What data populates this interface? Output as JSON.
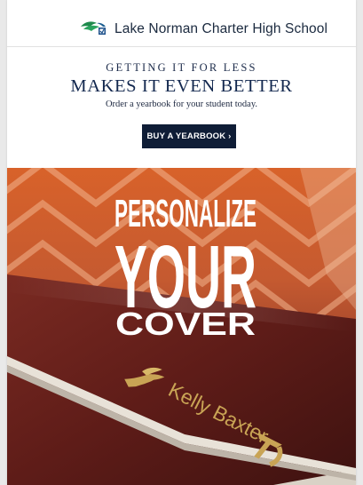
{
  "header": {
    "school_name": "Lake Norman Charter High School",
    "logo_icon": "bird-logo-icon"
  },
  "promo": {
    "kicker": "GETTING IT FOR LESS",
    "headline": "MAKES IT EVEN BETTER",
    "subtext": "Order a yearbook for your student today.",
    "cta_label": "BUY A YEARBOOK ›"
  },
  "hero": {
    "line1": "PERSONALIZE",
    "line2": "YOUR",
    "line3": "COVER",
    "cover_name": "Kelly Baxter",
    "emblem_icon": "winged-foot-icon",
    "initials_icon": "monogram-icon"
  },
  "colors": {
    "navy": "#13284f",
    "button": "#0f1d36",
    "orange": "#d8672e",
    "maroon": "#5a1c16",
    "gold": "#c9a455"
  }
}
